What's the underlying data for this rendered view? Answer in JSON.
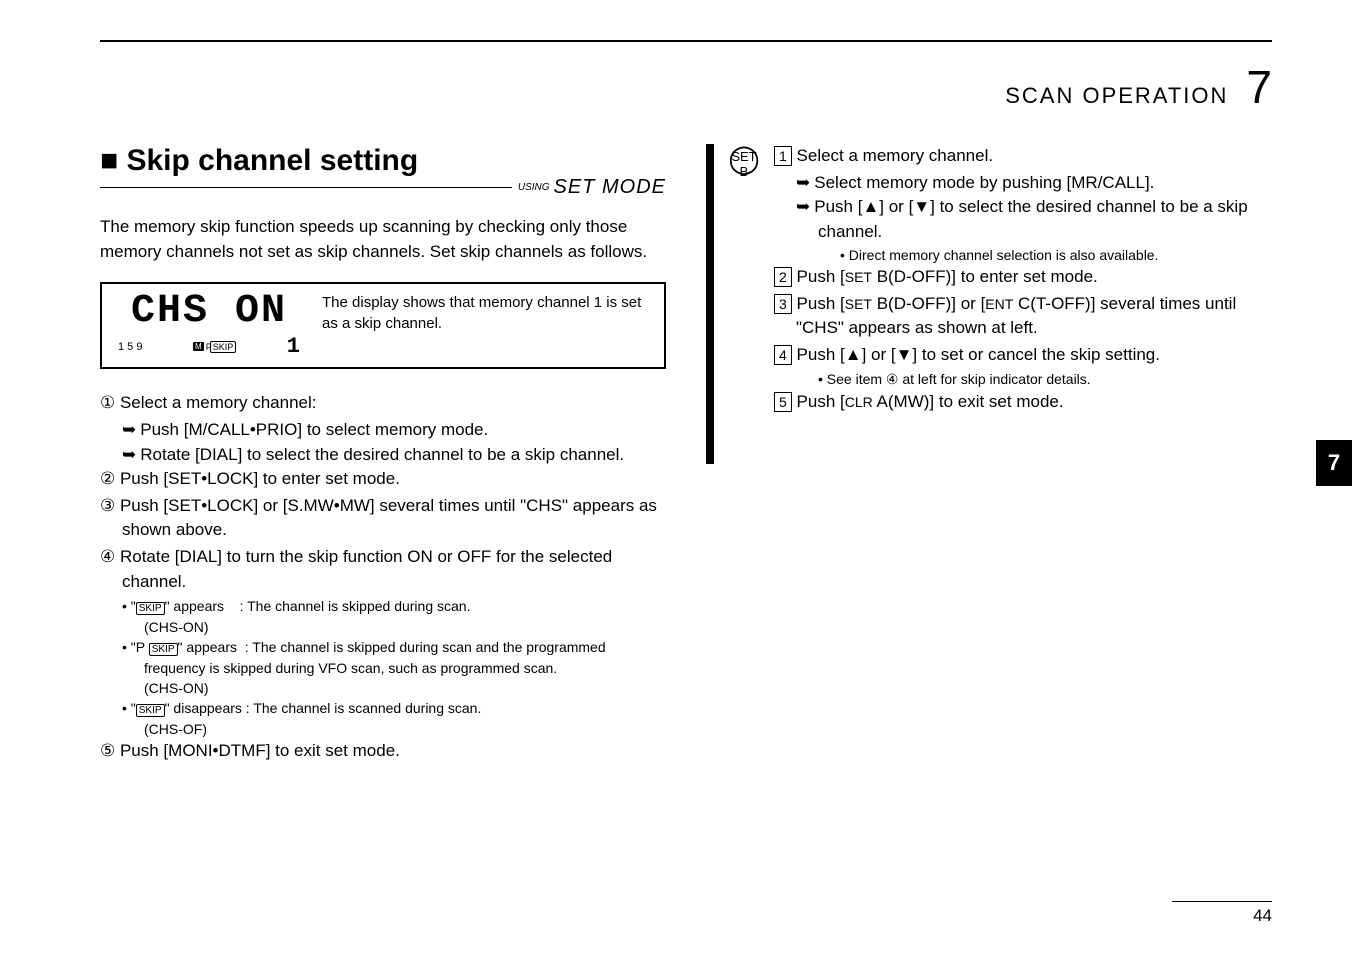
{
  "header": {
    "section": "SCAN OPERATION",
    "chapter_num": "7"
  },
  "left": {
    "title": "■ Skip channel setting",
    "set_mode_using": "USING",
    "set_mode": "SET MODE",
    "intro": "The memory skip function speeds up scanning by checking only those memory channels not set as skip channels. Set skip channels as follows.",
    "display": {
      "text": "CHS ON",
      "ticks": "1 5 9",
      "m_badge": "M",
      "p": "P",
      "skip": "SKIP",
      "sub_digit": "1",
      "desc": "The display shows that memory channel 1 is set as a skip channel."
    },
    "step1": "① Select a memory channel:",
    "step1a_arrow": "➥",
    "step1a": "Push [M/CALL•PRIO] to select memory mode.",
    "step1b_arrow": "➥",
    "step1b": "Rotate [DIAL] to select the desired channel to be a skip channel.",
    "step2": "② Push [SET•LOCK] to enter set mode.",
    "step3": "③ Push [SET•LOCK] or [S.MW•MW] several times until \"CHS\" appears as shown above.",
    "step4": "④ Rotate [DIAL] to turn the skip function ON or OFF for the selected channel.",
    "step4a_prefix": "• \"",
    "step4a_skip": "SKIP",
    "step4a_mid": "\" appears",
    "step4a_rest": ": The channel is skipped during scan.",
    "step4a_sub": "(CHS-ON)",
    "step4b_prefix": "• \"P ",
    "step4b_skip": "SKIP",
    "step4b_mid": "\" appears",
    "step4b_rest": ": The channel is skipped during scan and the programmed frequency is skipped during VFO scan, such as programmed scan.",
    "step4b_sub": "(CHS-ON)",
    "step4c_prefix": "• \"",
    "step4c_skip": "SKIP",
    "step4c_mid": "\" disappears : The channel is scanned during scan.",
    "step4c_sub": "(CHS-OF)",
    "step5": "⑤ Push [MONI•DTMF] to exit set mode."
  },
  "right": {
    "set_label": "SET",
    "b_label": "B",
    "step1_num": "1",
    "step1": "Select a memory channel.",
    "step1a_arrow": "➥",
    "step1a": "Select memory mode by pushing [MR/CALL].",
    "step1b_arrow": "➥",
    "step1b_pre": "Push [",
    "step1b_mid": "] or [",
    "step1b_post": "] to select the desired channel to be a skip channel.",
    "step1_note": "• Direct memory channel selection is also available.",
    "step2_num": "2",
    "step2_pre": "Push [",
    "step2_sc": "SET",
    "step2_post": " B(D-OFF)] to enter set mode.",
    "step3_num": "3",
    "step3_pre": "Push [",
    "step3_sc1": "SET",
    "step3_mid": " B(D-OFF)] or [",
    "step3_sc2": "ENT",
    "step3_post": " C(T-OFF)] several times until \"CHS\" appears as shown at left.",
    "step4_num": "4",
    "step4_pre": "Push [",
    "step4_mid": "] or [",
    "step4_post": "] to set or cancel the skip setting.",
    "step4_note": "• See item ④ at left for skip indicator details.",
    "step5_num": "5",
    "step5_pre": "Push [",
    "step5_sc": "CLR",
    "step5_post": " A(MW)] to exit set mode."
  },
  "side_tab": "7",
  "page_num": "44"
}
